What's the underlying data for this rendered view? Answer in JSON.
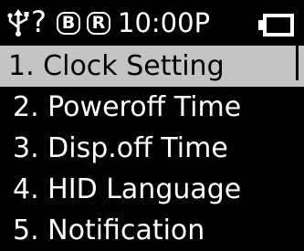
{
  "status_bar": {
    "usb_icon": "usb-icon",
    "help_label": "?",
    "badge_b": "B",
    "badge_r": "R",
    "time": "10:00P",
    "battery_icon": "battery-icon"
  },
  "menu": {
    "selected_index": 0,
    "items": [
      {
        "label": "1. Clock Setting"
      },
      {
        "label": "2.  Poweroff Time"
      },
      {
        "label": "3.  Disp.off Time"
      },
      {
        "label": "4.  HID Language"
      },
      {
        "label": "5.  Notification"
      }
    ]
  },
  "colors": {
    "background": "#000000",
    "text": "#ffffff",
    "highlight": "#c4c4c4",
    "highlight_text": "#000000"
  }
}
